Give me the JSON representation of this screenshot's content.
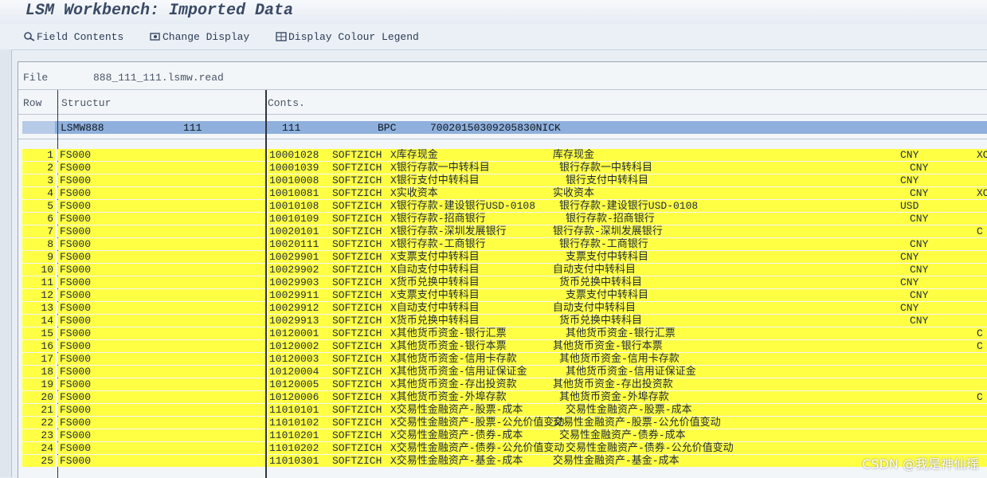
{
  "window": {
    "title": "LSM Workbench: Imported Data"
  },
  "toolbar": {
    "buttons": [
      {
        "label": "Field Contents",
        "icon": "field-contents-icon"
      },
      {
        "label": "Change Display",
        "icon": "change-display-icon"
      },
      {
        "label": "Display Colour Legend",
        "icon": "colour-legend-icon"
      }
    ]
  },
  "file": {
    "label": "File",
    "value": "888_111_111.lsmw.read"
  },
  "columns": {
    "row": "Row",
    "structure": "Structur",
    "contents": "Conts."
  },
  "header_record": {
    "structure": "LSMW888",
    "v1": "111",
    "v2": "111",
    "v3": "BPC",
    "v4": "70020150309205830NICK"
  },
  "rows": [
    {
      "row": "1",
      "struct": "FS000",
      "acct": "10001028",
      "co": "SOFTZICH",
      "text": "X库存现金",
      "text2": "库存现金",
      "cur": "CNY",
      "tail": "XO"
    },
    {
      "row": "2",
      "struct": "FS000",
      "acct": "10001039",
      "co": "SOFTZICH",
      "text": "X银行存款一中转科目",
      "text2": "银行存款一中转科目",
      "cur": "CNY",
      "tail": ""
    },
    {
      "row": "3",
      "struct": "FS000",
      "acct": "10010008",
      "co": "SOFTZICH",
      "text": "X银行支付中转科目",
      "text2": "银行支付中转科目",
      "cur": "CNY",
      "tail": ""
    },
    {
      "row": "4",
      "struct": "FS000",
      "acct": "10010081",
      "co": "SOFTZICH",
      "text": "X实收资本",
      "text2": "实收资本",
      "cur": "CNY",
      "tail": "XO"
    },
    {
      "row": "5",
      "struct": "FS000",
      "acct": "10010108",
      "co": "SOFTZICH",
      "text": "X银行存款-建设银行USD-0108",
      "text2": "银行存款-建设银行USD-0108",
      "cur": "USD",
      "tail": ""
    },
    {
      "row": "6",
      "struct": "FS000",
      "acct": "10010109",
      "co": "SOFTZICH",
      "text": "X银行存款-招商银行",
      "text2": "银行存款-招商银行",
      "cur": "CNY",
      "tail": ""
    },
    {
      "row": "7",
      "struct": "FS000",
      "acct": "10020101",
      "co": "SOFTZICH",
      "text": "X银行存款-深圳发展银行",
      "text2": "银行存款-深圳发展银行",
      "cur": "",
      "tail": "C"
    },
    {
      "row": "8",
      "struct": "FS000",
      "acct": "10020111",
      "co": "SOFTZICH",
      "text": "X银行存款-工商银行",
      "text2": "银行存款-工商银行",
      "cur": "CNY",
      "tail": ""
    },
    {
      "row": "9",
      "struct": "FS000",
      "acct": "10029901",
      "co": "SOFTZICH",
      "text": "X支票支付中转科目",
      "text2": "支票支付中转科目",
      "cur": "CNY",
      "tail": ""
    },
    {
      "row": "10",
      "struct": "FS000",
      "acct": "10029902",
      "co": "SOFTZICH",
      "text": "X自动支付中转科目",
      "text2": "自动支付中转科目",
      "cur": "CNY",
      "tail": ""
    },
    {
      "row": "11",
      "struct": "FS000",
      "acct": "10029903",
      "co": "SOFTZICH",
      "text": "X货币兑换中转科目",
      "text2": "货币兑换中转科目",
      "cur": "CNY",
      "tail": ""
    },
    {
      "row": "12",
      "struct": "FS000",
      "acct": "10029911",
      "co": "SOFTZICH",
      "text": "X支票支付中转科目",
      "text2": "支票支付中转科目",
      "cur": "CNY",
      "tail": ""
    },
    {
      "row": "13",
      "struct": "FS000",
      "acct": "10029912",
      "co": "SOFTZICH",
      "text": "X自动支付中转科目",
      "text2": "自动支付中转科目",
      "cur": "CNY",
      "tail": ""
    },
    {
      "row": "14",
      "struct": "FS000",
      "acct": "10029913",
      "co": "SOFTZICH",
      "text": "X货币兑换中转科目",
      "text2": "货币兑换中转科目",
      "cur": "CNY",
      "tail": ""
    },
    {
      "row": "15",
      "struct": "FS000",
      "acct": "10120001",
      "co": "SOFTZICH",
      "text": "X其他货币资金-银行汇票",
      "text2": "其他货币资金-银行汇票",
      "cur": "",
      "tail": "C"
    },
    {
      "row": "16",
      "struct": "FS000",
      "acct": "10120002",
      "co": "SOFTZICH",
      "text": "X其他货币资金-银行本票",
      "text2": "其他货币资金-银行本票",
      "cur": "",
      "tail": "C"
    },
    {
      "row": "17",
      "struct": "FS000",
      "acct": "10120003",
      "co": "SOFTZICH",
      "text": "X其他货币资金-信用卡存款",
      "text2": "其他货币资金-信用卡存款",
      "cur": "",
      "tail": ""
    },
    {
      "row": "18",
      "struct": "FS000",
      "acct": "10120004",
      "co": "SOFTZICH",
      "text": "X其他货币资金-信用证保证金",
      "text2": "其他货币资金-信用证保证金",
      "cur": "",
      "tail": ""
    },
    {
      "row": "19",
      "struct": "FS000",
      "acct": "10120005",
      "co": "SOFTZICH",
      "text": "X其他货币资金-存出投资款",
      "text2": "其他货币资金-存出投资款",
      "cur": "",
      "tail": ""
    },
    {
      "row": "20",
      "struct": "FS000",
      "acct": "10120006",
      "co": "SOFTZICH",
      "text": "X其他货币资金-外埠存款",
      "text2": "其他货币资金-外埠存款",
      "cur": "",
      "tail": "C"
    },
    {
      "row": "21",
      "struct": "FS000",
      "acct": "11010101",
      "co": "SOFTZICH",
      "text": "X交易性金融资产-股票-成本",
      "text2": "交易性金融资产-股票-成本",
      "cur": "",
      "tail": ""
    },
    {
      "row": "22",
      "struct": "FS000",
      "acct": "11010102",
      "co": "SOFTZICH",
      "text": "X交易性金融资产-股票-公允价值变动",
      "text2": "交易性金融资产-股票-公允价值变动",
      "cur": "",
      "tail": ""
    },
    {
      "row": "23",
      "struct": "FS000",
      "acct": "11010201",
      "co": "SOFTZICH",
      "text": "X交易性金融资产-债券-成本",
      "text2": "交易性金融资产-债券-成本",
      "cur": "",
      "tail": ""
    },
    {
      "row": "24",
      "struct": "FS000",
      "acct": "11010202",
      "co": "SOFTZICH",
      "text": "X交易性金融资产-债券-公允价值变动",
      "text2": "交易性金融资产-债券-公允价值变动",
      "cur": "",
      "tail": ""
    },
    {
      "row": "25",
      "struct": "FS000",
      "acct": "11010301",
      "co": "SOFTZICH",
      "text": "X交易性金融资产-基金-成本",
      "text2": "交易性金融资产-基金-成本",
      "cur": "",
      "tail": ""
    }
  ],
  "watermark": "CSDN @我是神仙瑶",
  "colors": {
    "highlight": "#ffff44",
    "header_row": "#8fb0dc"
  }
}
